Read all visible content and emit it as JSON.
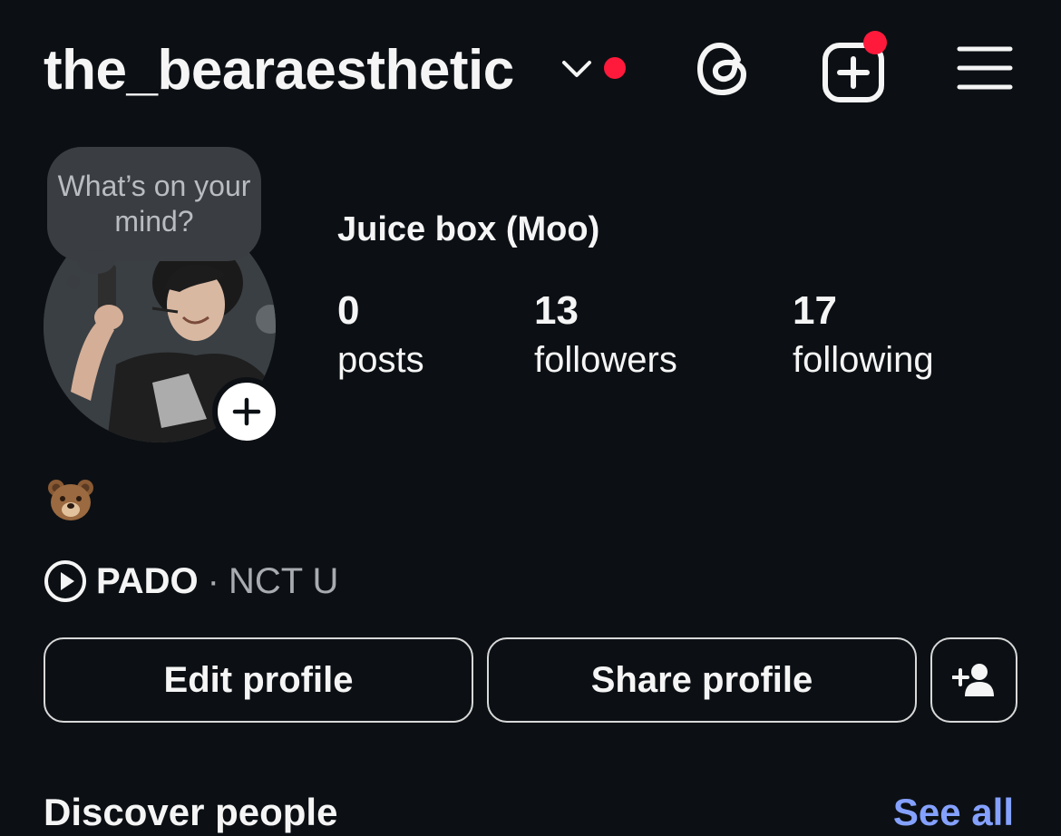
{
  "header": {
    "username": "the_bearaesthetic",
    "icons": {
      "switcher": "chevron-down-icon",
      "threads": "threads-icon",
      "create": "create-post-icon",
      "menu": "hamburger-menu-icon"
    },
    "notification_color": "#ff1a3c"
  },
  "profile": {
    "note_text": "What’s on your mind?",
    "display_name": "Juice box (Moo)",
    "stats": [
      {
        "value": "0",
        "label": "posts"
      },
      {
        "value": "13",
        "label": "followers"
      },
      {
        "value": "17",
        "label": "following"
      }
    ],
    "bio_emoji": "bear-face-emoji",
    "music": {
      "song": "PADO",
      "separator": "·",
      "artist": "NCT U"
    }
  },
  "buttons": {
    "edit_profile": "Edit profile",
    "share_profile": "Share profile",
    "discover_people_icon": "add-person-icon"
  },
  "discover": {
    "title": "Discover people",
    "see_all": "See all"
  },
  "colors": {
    "background": "#0c1014",
    "text": "#f5f5f5",
    "secondary_text": "#a8abb0",
    "link": "#85a1ff"
  }
}
